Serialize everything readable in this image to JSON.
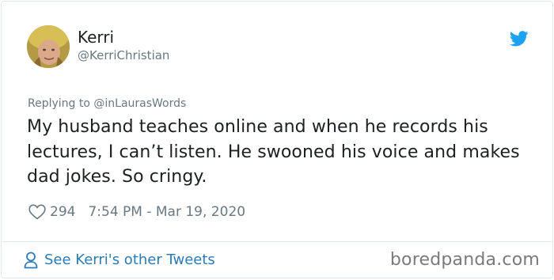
{
  "author": {
    "display_name": "Kerri",
    "handle": "@KerriChristian",
    "avatar_icon": "user-avatar-photo"
  },
  "reply": {
    "prefix": "Replying to",
    "target_handle": "@inLaurasWords"
  },
  "tweet": {
    "text": "My husband teaches online and when he records his lectures, I can’t listen. He swooned his voice and makes dad jokes. So cringy.",
    "like_count": "294",
    "timestamp": "7:54 PM - Mar 19, 2020"
  },
  "footer": {
    "see_more_label": "See Kerri's other Tweets",
    "watermark": "boredpanda.com"
  },
  "colors": {
    "twitter_blue": "#1da1f2",
    "link_blue": "#2b7bb9",
    "muted_text": "#697882",
    "body_text": "#1c2022",
    "border": "#e1e8ed"
  },
  "icons": {
    "brand": "twitter-bird-icon",
    "like": "heart-outline-icon",
    "profile": "person-outline-icon"
  }
}
